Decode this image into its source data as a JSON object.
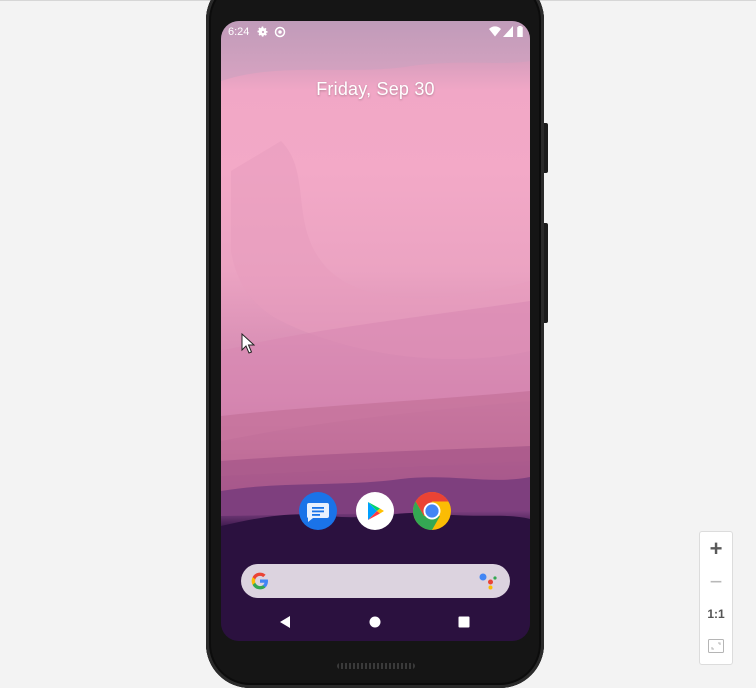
{
  "status_bar": {
    "time": "6:24",
    "icons": [
      "settings-icon",
      "sync-icon",
      "wifi-icon",
      "cellular-signal-icon",
      "battery-icon"
    ]
  },
  "home": {
    "date": "Friday, Sep 30"
  },
  "dock": {
    "apps": [
      {
        "name": "Messages",
        "icon": "messages-icon",
        "color": "#1a73e8"
      },
      {
        "name": "Play Store",
        "icon": "play-store-icon",
        "color": "#ffffff"
      },
      {
        "name": "Chrome",
        "icon": "chrome-icon",
        "color": "#ea4335"
      }
    ]
  },
  "search": {
    "icons": [
      "google-g-icon",
      "google-assistant-icon"
    ]
  },
  "nav": {
    "buttons": [
      "back-icon",
      "home-icon",
      "recents-icon"
    ]
  },
  "zoom_controls": {
    "zoom_in": "+",
    "zoom_out": "−",
    "actual_size": "1:1",
    "fit_icon": "fit-screen-icon"
  },
  "colors": {
    "wallpaper_top": "#f3a9c7",
    "wallpaper_bottom": "#26103b",
    "accent": "#1a73e8"
  }
}
